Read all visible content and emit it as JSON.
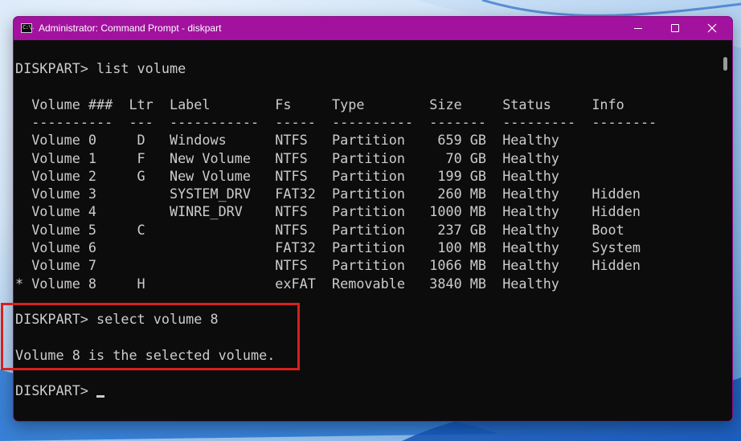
{
  "window": {
    "title": "Administrator: Command Prompt - diskpart",
    "app_icon_text": "C:\\."
  },
  "controls": {
    "minimize": "minimize",
    "maximize": "maximize",
    "close": "close"
  },
  "console": {
    "lines": [
      "DISKPART> list volume",
      "",
      "  Volume ###  Ltr  Label        Fs     Type        Size     Status     Info",
      "  ----------  ---  -----------  -----  ----------  -------  ---------  --------",
      "  Volume 0     D   Windows      NTFS   Partition    659 GB  Healthy",
      "  Volume 1     F   New Volume   NTFS   Partition     70 GB  Healthy",
      "  Volume 2     G   New Volume   NTFS   Partition    199 GB  Healthy",
      "  Volume 3         SYSTEM_DRV   FAT32  Partition    260 MB  Healthy    Hidden",
      "  Volume 4         WINRE_DRV    NTFS   Partition   1000 MB  Healthy    Hidden",
      "  Volume 5     C                NTFS   Partition    237 GB  Healthy    Boot",
      "  Volume 6                      FAT32  Partition    100 MB  Healthy    System",
      "  Volume 7                      NTFS   Partition   1066 MB  Healthy    Hidden",
      "* Volume 8     H                exFAT  Removable   3840 MB  Healthy",
      "",
      "DISKPART> select volume 8",
      "",
      "Volume 8 is the selected volume.",
      "",
      "DISKPART> "
    ]
  },
  "colors": {
    "titlebar": "#a2129e",
    "console_bg": "#0c0c0c",
    "console_text": "#cccccc",
    "highlight": "#d8201c"
  }
}
